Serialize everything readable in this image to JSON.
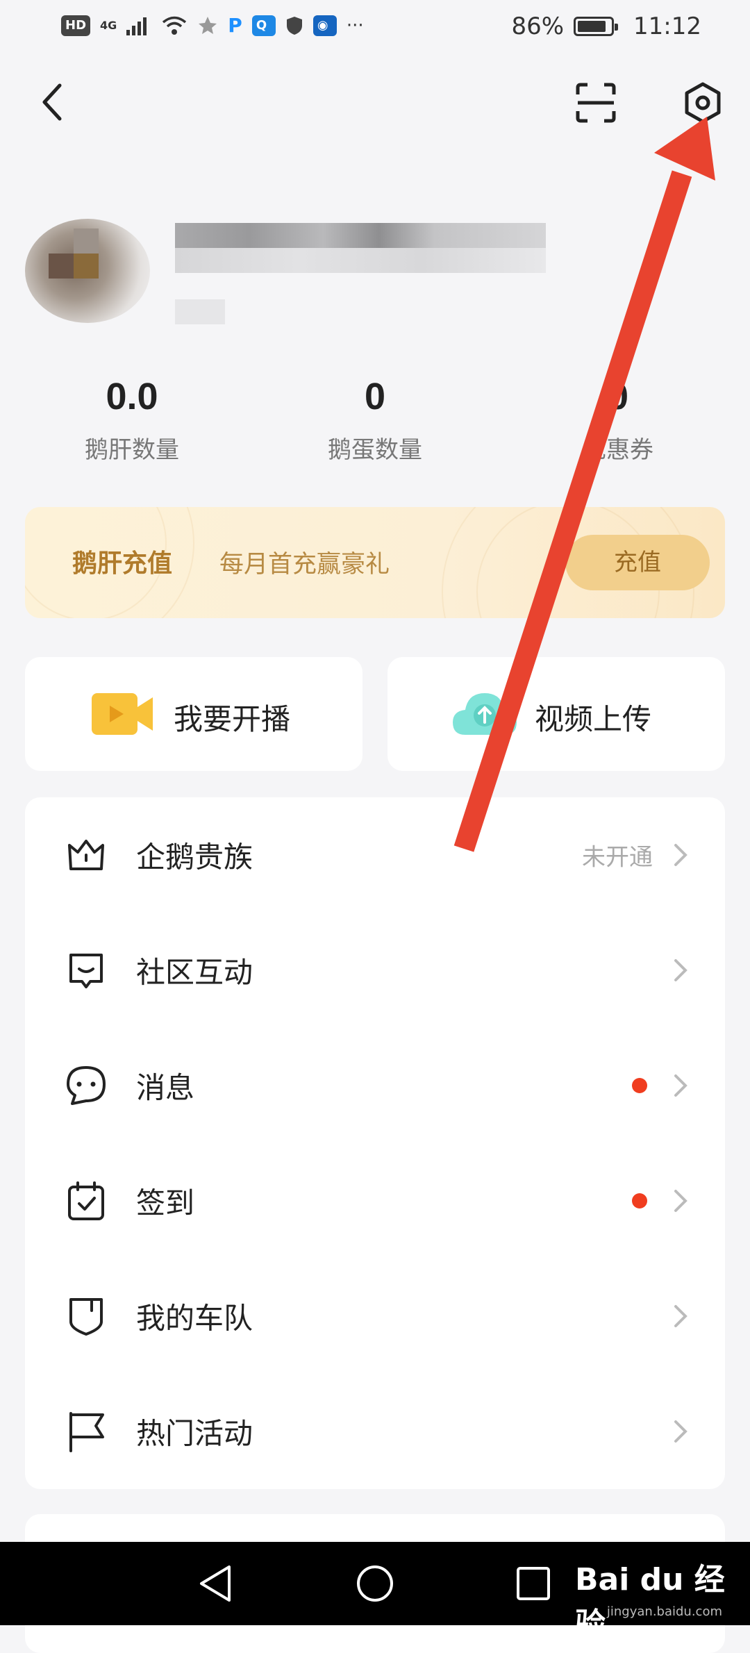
{
  "status_bar": {
    "left_text": [
      "HD",
      "4G"
    ],
    "more": "···",
    "battery": "86%",
    "battery_level": 0.86,
    "time": "11:12"
  },
  "header": {
    "back_icon": "back-arrow-icon",
    "scan_icon": "scan-icon",
    "settings_icon": "settings-gear-icon"
  },
  "stats": [
    {
      "value": "0.0",
      "label": "鹅肝数量"
    },
    {
      "value": "0",
      "label": "鹅蛋数量"
    },
    {
      "value": "0",
      "label": "优惠券"
    }
  ],
  "banner": {
    "title": "鹅肝充值",
    "subtitle": "每月首充赢豪礼",
    "button": "充值"
  },
  "actions": [
    {
      "label": "我要开播",
      "icon": "video-camera-icon"
    },
    {
      "label": "视频上传",
      "icon": "cloud-upload-icon"
    }
  ],
  "menu": [
    {
      "label": "企鹅贵族",
      "status": "未开通",
      "icon": "crown-icon",
      "dot": false
    },
    {
      "label": "社区互动",
      "status": "",
      "icon": "chat-bubble-smile-icon",
      "dot": false
    },
    {
      "label": "消息",
      "status": "",
      "icon": "message-icon",
      "dot": true
    },
    {
      "label": "签到",
      "status": "",
      "icon": "calendar-check-icon",
      "dot": true
    },
    {
      "label": "我的车队",
      "status": "",
      "icon": "shield-icon",
      "dot": false
    },
    {
      "label": "热门活动",
      "status": "",
      "icon": "flag-icon",
      "dot": false
    }
  ],
  "colors": {
    "arrow": "#e8432f",
    "banner_text": "#b07b2b",
    "dot": "#f03d1f"
  },
  "watermark": {
    "brand": "Bai du 经验",
    "url": "jingyan.baidu.com"
  }
}
